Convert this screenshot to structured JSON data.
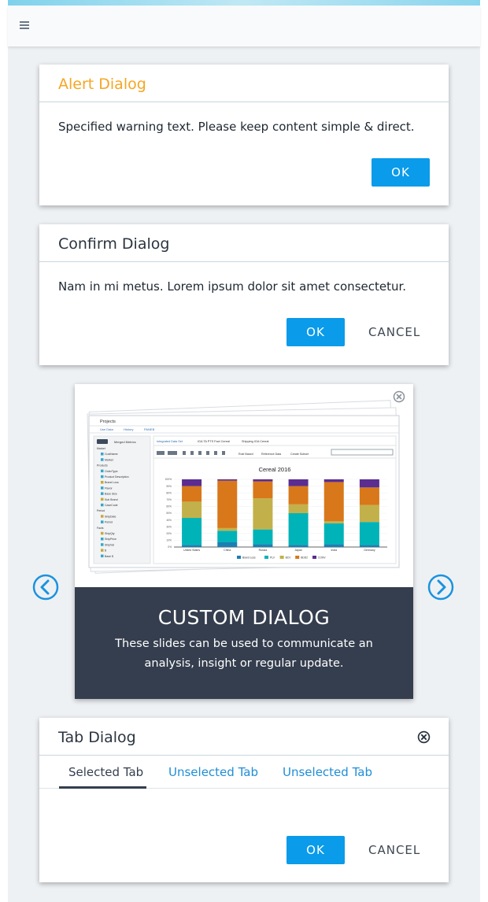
{
  "appbar": {
    "menu_icon": "hamburger-icon"
  },
  "alert_dialog": {
    "title": "Alert Dialog",
    "title_color": "#f5a623",
    "message": "Specified warning text. Please keep content simple & direct.",
    "ok_label": "OK"
  },
  "confirm_dialog": {
    "title": "Confirm Dialog",
    "message": "Nam in mi metus. Lorem ipsum dolor sit amet consectetur.",
    "ok_label": "OK",
    "cancel_label": "CANCEL"
  },
  "custom_dialog": {
    "title": "CUSTOM DIALOG",
    "description": "These slides can be used to communicate an analysis, insight or regular update.",
    "close_icon": "close-circle-icon",
    "prev_icon": "chevron-left-circle-icon",
    "next_icon": "chevron-right-circle-icon",
    "preview": {
      "window_title": "Projects",
      "nav_tabs": [
        "Use Data",
        "History",
        "PANEB"
      ],
      "sidebar_title": "Merged Metrics",
      "sidebar_items": [
        "Market",
        "CustName",
        "Market",
        "Products",
        "OrderType",
        "Product Description",
        "Brand Loss",
        "Flavor",
        "Base Size",
        "Sub Brand",
        "CaseCode",
        "Period",
        "ShipDate",
        "Period",
        "Facts",
        "ShipQty",
        "ShipPrice",
        "ShipVal",
        "$",
        "Base $"
      ],
      "content_tabs": [
        "Integrated Data Set",
        "IGA TA PTS Fact Cereal",
        "Shipping IGA Cereal"
      ],
      "toolbar_items": [
        "Rule Based",
        "Reference Data",
        "Create Subset"
      ],
      "chart_title": "Cereal 2016"
    }
  },
  "chart_data": {
    "type": "bar",
    "stacked": true,
    "title": "Cereal 2016",
    "categories": [
      "United States",
      "China",
      "Russia",
      "Japan",
      "India",
      "Germany"
    ],
    "ylim": [
      0,
      100
    ],
    "yticks": [
      "0%",
      "10%",
      "20%",
      "30%",
      "40%",
      "50%",
      "60%",
      "70%",
      "80%",
      "90%",
      "100%"
    ],
    "series": [
      {
        "name": "Brand Loss",
        "color": "#1b7fb3",
        "values": [
          3,
          7,
          4,
          3,
          4,
          3
        ]
      },
      {
        "name": "PLV",
        "color": "#00b3b8",
        "values": [
          40,
          17,
          22,
          47,
          31,
          34
        ]
      },
      {
        "name": "BCV",
        "color": "#c2b14a",
        "values": [
          24,
          4,
          46,
          13,
          3,
          25
        ]
      },
      {
        "name": "BDD2",
        "color": "#d8781a",
        "values": [
          23,
          70,
          25,
          27,
          58,
          26
        ]
      },
      {
        "name": "CONV",
        "color": "#5b2d91",
        "values": [
          10,
          2,
          3,
          10,
          4,
          12
        ]
      }
    ],
    "legend": "bottom"
  },
  "tab_dialog": {
    "title": "Tab Dialog",
    "close_icon": "close-circle-icon",
    "tabs": [
      "Selected Tab",
      "Unselected Tab",
      "Unselected Tab"
    ],
    "selected_color": "#353e4e",
    "unselected_color": "#1f8ed6",
    "ok_label": "OK",
    "cancel_label": "CANCEL"
  }
}
